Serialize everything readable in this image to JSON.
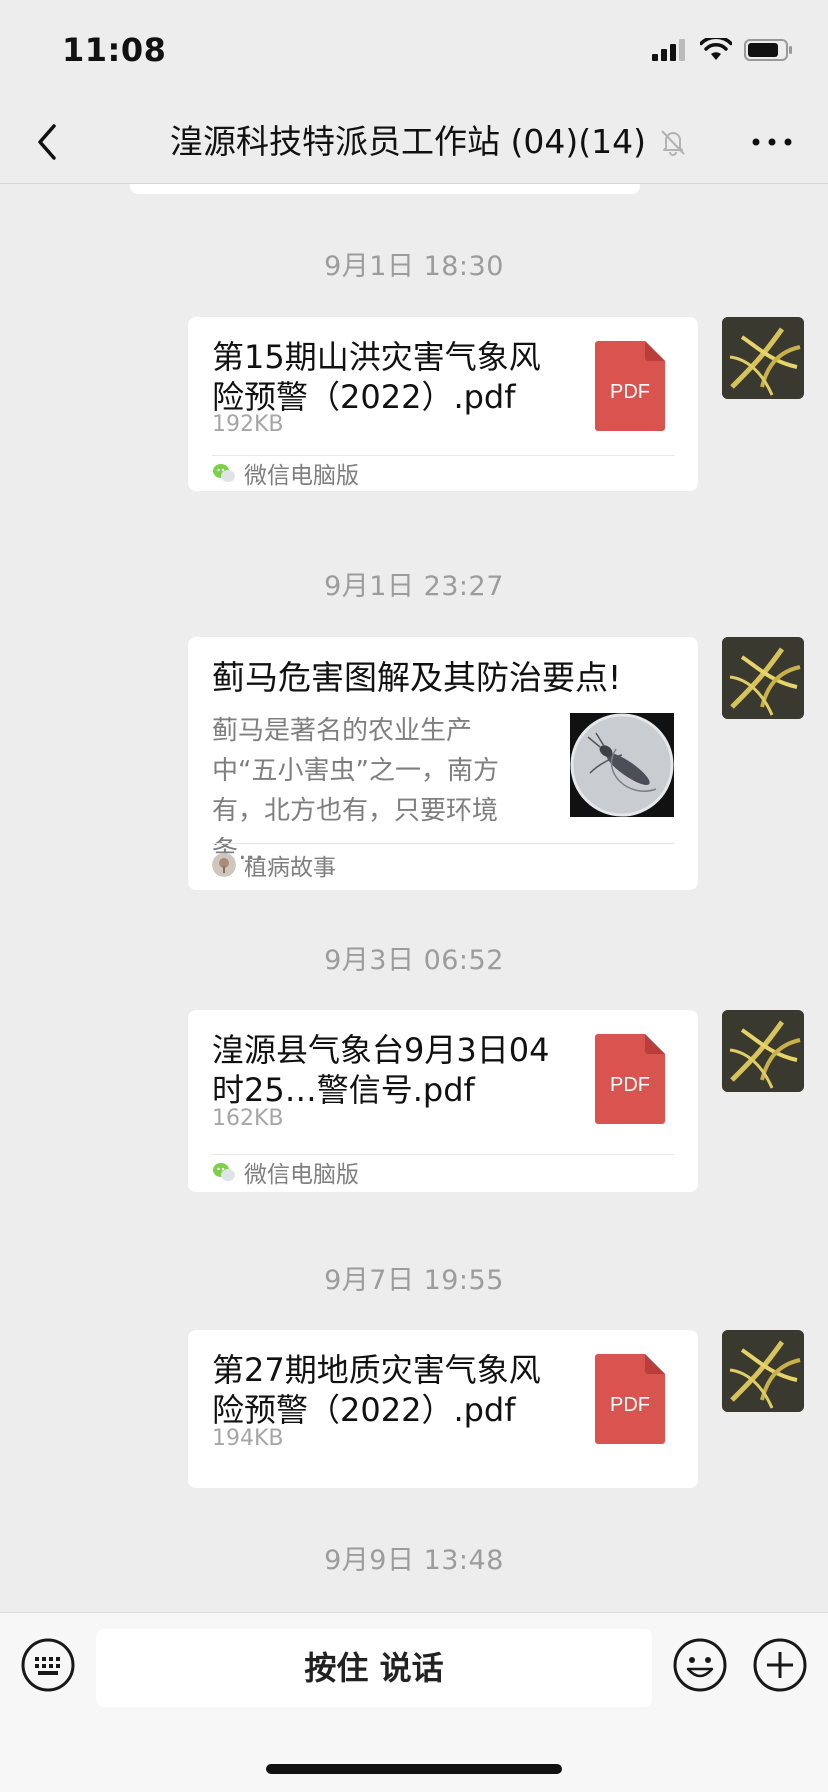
{
  "status_bar": {
    "time": "11:08"
  },
  "nav": {
    "title": "湟源科技特派员工作站 (04)(14)"
  },
  "messages": [
    {
      "timestamp": "9月1日 18:30",
      "type": "file",
      "title": "第15期山洪灾害气象风险预警（2022）.pdf",
      "size": "192KB",
      "file_icon_label": "PDF",
      "source": "微信电脑版"
    },
    {
      "timestamp": "9月1日 23:27",
      "type": "article",
      "title": "蓟马危害图解及其防治要点!",
      "description": "蓟马是著名的农业生产中“五小害虫”之一，南方有，北方也有，只要环境条…",
      "source": "植病故事"
    },
    {
      "timestamp": "9月3日 06:52",
      "type": "file",
      "title": "湟源县气象台9月3日04时25…警信号.pdf",
      "size": "162KB",
      "file_icon_label": "PDF",
      "source": "微信电脑版"
    },
    {
      "timestamp": "9月7日 19:55",
      "type": "file",
      "title": "第27期地质灾害气象风险预警（2022）.pdf",
      "size": "194KB",
      "file_icon_label": "PDF"
    },
    {
      "timestamp": "9月9日 13:48"
    }
  ],
  "input_bar": {
    "talk_label": "按住 说话"
  },
  "colors": {
    "background": "#ededed",
    "pdf_red": "#d9534f",
    "timestamp_gray": "#9c9c9c",
    "wechat_green": "#7bd148"
  },
  "icons": {
    "back": "chevron-left-icon",
    "mute": "bell-slash-icon",
    "more": "more-dots-icon",
    "keyboard": "keyboard-icon",
    "emoji": "emoji-icon",
    "plus": "plus-icon",
    "file": "pdf-icon",
    "source_pc": "wechat-pc-icon"
  }
}
